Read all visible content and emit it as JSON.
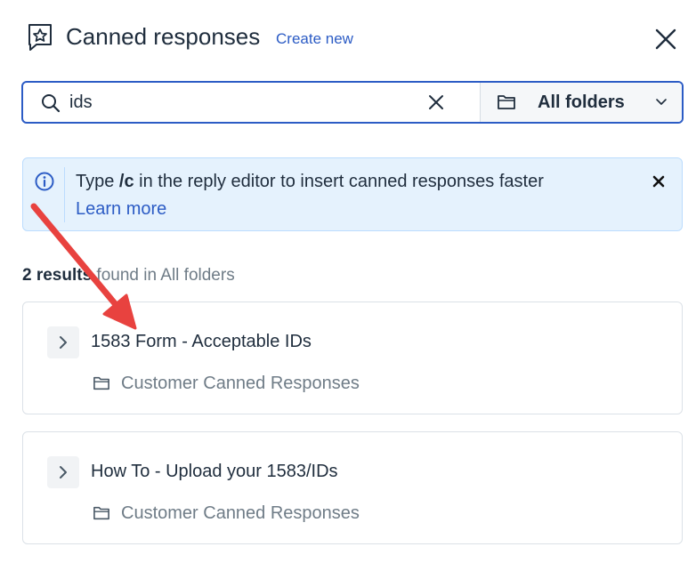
{
  "header": {
    "title": "Canned responses",
    "create_new": "Create new",
    "icon": "star-bubble-icon",
    "close_icon": "close-icon"
  },
  "search": {
    "value": "ids",
    "placeholder": "",
    "clear_icon": "clear-icon",
    "folder_filter": {
      "icon": "folder-icon",
      "selected": "All folders"
    }
  },
  "banner": {
    "text_before": "Type ",
    "shortcut": "/c",
    "text_after": " in the reply editor to insert canned responses faster",
    "link": "Learn more"
  },
  "results": {
    "count": "2 results",
    "suffix": " found in All folders",
    "items": [
      {
        "title": "1583 Form - Acceptable IDs",
        "folder": "Customer Canned Responses"
      },
      {
        "title": "How To - Upload your 1583/IDs",
        "folder": "Customer Canned Responses"
      }
    ]
  },
  "colors": {
    "accent": "#2c5cc5",
    "text": "#1f2d3d",
    "muted": "#6f7c87",
    "banner_bg": "#e5f2fd",
    "annotation_arrow": "#e8423f"
  }
}
